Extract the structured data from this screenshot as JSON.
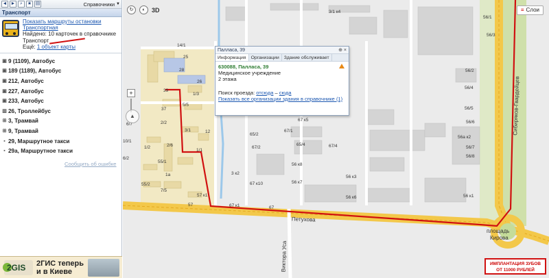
{
  "toolbar": {
    "directory_label": "Справочники"
  },
  "section_header": "Транспорт",
  "rubric": {
    "show_routes": "Показать маршруты остановки",
    "category": "Транспортная",
    "found": "Найдено: 10 карточек в справочнике",
    "category_tail": "Транспорт",
    "more_prefix": "Ещё:",
    "more_link": "1 объект карты"
  },
  "routes": [
    {
      "label": "9 (1109), Автобус",
      "icon": "bus-icon"
    },
    {
      "label": "189 (1189), Автобус",
      "icon": "bus-icon"
    },
    {
      "label": "212, Автобус",
      "icon": "bus-icon"
    },
    {
      "label": "227, Автобус",
      "icon": "bus-icon"
    },
    {
      "label": "233, Автобус",
      "icon": "bus-icon"
    },
    {
      "label": "26, Троллейбус",
      "icon": "trolleybus-icon"
    },
    {
      "label": "3, Трамвай",
      "icon": "tram-icon"
    },
    {
      "label": "9, Трамвай",
      "icon": "tram-icon"
    },
    {
      "label": "29, Маршрутное такси",
      "icon": "taxi-icon"
    },
    {
      "label": "29а, Маршрутное такси",
      "icon": "taxi-icon"
    }
  ],
  "report_link": "Сообщить об ошибке",
  "ad_2gis": {
    "logo": "2GIS",
    "slogan_line1": "2ГИС теперь",
    "slogan_line2": "и в Киеве"
  },
  "map": {
    "layers_label": "Слои",
    "view_3d": "3D",
    "scale_label": "",
    "street_petukhova": "Петухова",
    "street_viktora_usa": "Виктора Уса",
    "street_sibiryakov": "Сибиряков-Гвардейцев",
    "square_kirova_1": "площадь",
    "square_kirova_2": "Кирова",
    "labels": [
      "3/1 к4",
      "56/1",
      "56/3",
      "56/4",
      "56/5",
      "56/6",
      "56/7",
      "56/8",
      "56а к2",
      "56/2",
      "56 к1",
      "67 к5",
      "67/1",
      "65/2",
      "67/2",
      "65/4",
      "56 к8",
      "56 к7",
      "67 к10",
      "56 к3",
      "56 к6",
      "67/4",
      "3 к2",
      "67 к1",
      "67",
      "57 к1",
      "57",
      "55/1",
      "1а",
      "1/2",
      "2/6",
      "2/2",
      "1/1",
      "3/1",
      "5/5",
      "7/5",
      "6/2",
      "37",
      "39",
      "26",
      "28",
      "14/1",
      "12",
      "6/7",
      "10/1",
      "25",
      "1/3",
      "55/2"
    ]
  },
  "popup": {
    "title": "Палласа, 39",
    "tabs": [
      "Информация",
      "Организации",
      "Здание обслуживает"
    ],
    "address": "630088, Палласа, 39",
    "type": "Медицинское учреждение",
    "floors": "2 этажа",
    "route_prefix": "Поиск проезда:",
    "route_from": "отсюда",
    "route_dash": "–",
    "route_to": "сюда",
    "show_all": "Показать все организации здания в справочнике (1)"
  },
  "ad_implant": {
    "line1": "ИМПЛАНТАЦИЯ ЗУБОВ",
    "line2": "ОТ 11000 РУБЛЕЙ"
  },
  "colors": {
    "route_red": "#d01010",
    "main_road": "#f3c84a",
    "water": "#9cc8ea",
    "residential": "#f2e9c4",
    "industrial": "#d7d7d7"
  }
}
